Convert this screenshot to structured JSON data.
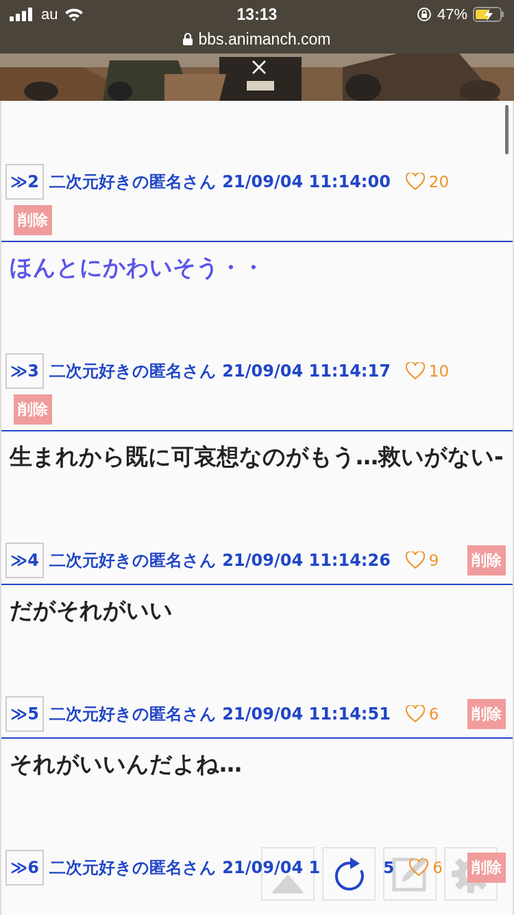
{
  "status_bar": {
    "carrier": "au",
    "time": "13:13",
    "battery": "47%",
    "url": "bbs.animanch.com"
  },
  "posts": [
    {
      "number": "≫2",
      "meta": "二次元好きの匿名さん 21/09/04 11:14:00",
      "likes": "20",
      "delete": "削除",
      "kind": "stacked",
      "color": "#5a55e8",
      "body": "ほんとにかわいそう・・"
    },
    {
      "number": "≫3",
      "meta": "二次元好きの匿名さん 21/09/04 11:14:17",
      "likes": "10",
      "delete": "削除",
      "kind": "stacked",
      "color": "#222222",
      "body": "生まれから既に可哀想なのがもう…救いがない-"
    },
    {
      "number": "≫4",
      "meta": "二次元好きの匿名さん 21/09/04 11:14:26",
      "likes": "9",
      "delete": "削除",
      "kind": "inline",
      "color": "#222222",
      "body": "だがそれがいい"
    },
    {
      "number": "≫5",
      "meta": "二次元好きの匿名さん 21/09/04 11:14:51",
      "likes": "6",
      "delete": "削除",
      "kind": "inline",
      "color": "#222222",
      "body": "それがいいんだよね…"
    },
    {
      "number": "≫6",
      "meta": "二次元好きの匿名さん 21/09/04 1",
      "meta_tail": "5",
      "likes": "6",
      "delete": "削除",
      "kind": "inline"
    }
  ]
}
